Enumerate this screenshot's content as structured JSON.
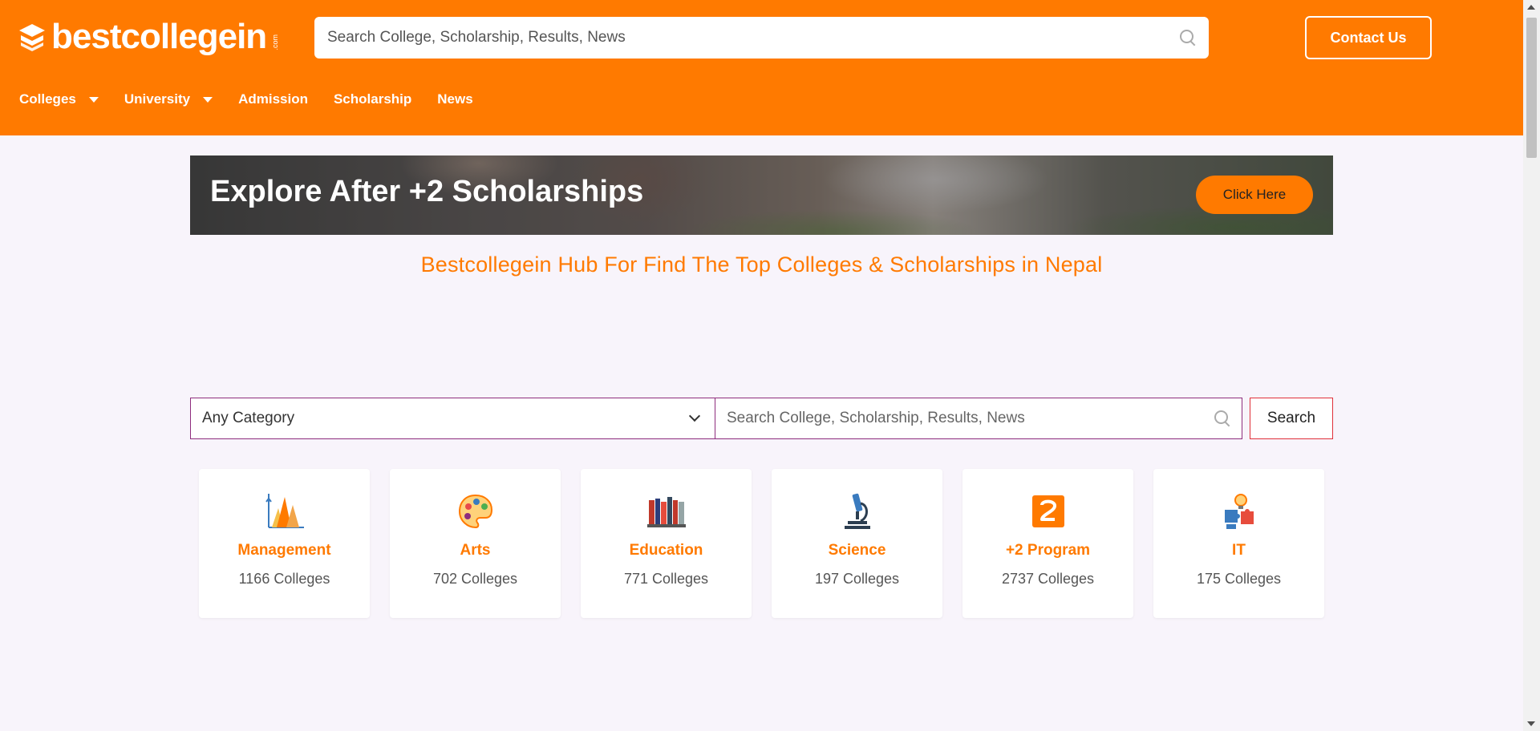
{
  "header": {
    "logo_text": "bestcollegein",
    "logo_suffix": ".com",
    "search_placeholder": "Search College, Scholarship, Results, News",
    "contact_label": "Contact Us",
    "nav": [
      {
        "label": "Colleges",
        "dropdown": true
      },
      {
        "label": "University",
        "dropdown": true
      },
      {
        "label": "Admission",
        "dropdown": false
      },
      {
        "label": "Scholarship",
        "dropdown": false
      },
      {
        "label": "News",
        "dropdown": false
      }
    ],
    "bg_color": "#ff7a00"
  },
  "banner": {
    "title": "Explore After +2 Scholarships",
    "button_label": "Click Here"
  },
  "headline": "Bestcollegein Hub For Find The Top Colleges & Scholarships in Nepal",
  "search": {
    "category_value": "Any Category",
    "placeholder": "Search College, Scholarship, Results, News",
    "button_label": "Search"
  },
  "categories": [
    {
      "name": "Management",
      "count": "1166 Colleges",
      "icon": "chart-icon"
    },
    {
      "name": "Arts",
      "count": "702 Colleges",
      "icon": "palette-icon"
    },
    {
      "name": "Education",
      "count": "771 Colleges",
      "icon": "books-icon"
    },
    {
      "name": "Science",
      "count": "197 Colleges",
      "icon": "microscope-icon"
    },
    {
      "name": "+2 Program",
      "count": "2737 Colleges",
      "icon": "number-two-icon"
    },
    {
      "name": "IT",
      "count": "175 Colleges",
      "icon": "puzzle-bulb-icon"
    }
  ],
  "colors": {
    "accent": "#ff7a00",
    "border": "#8e2d7d",
    "search_btn_border": "#e0303a"
  }
}
